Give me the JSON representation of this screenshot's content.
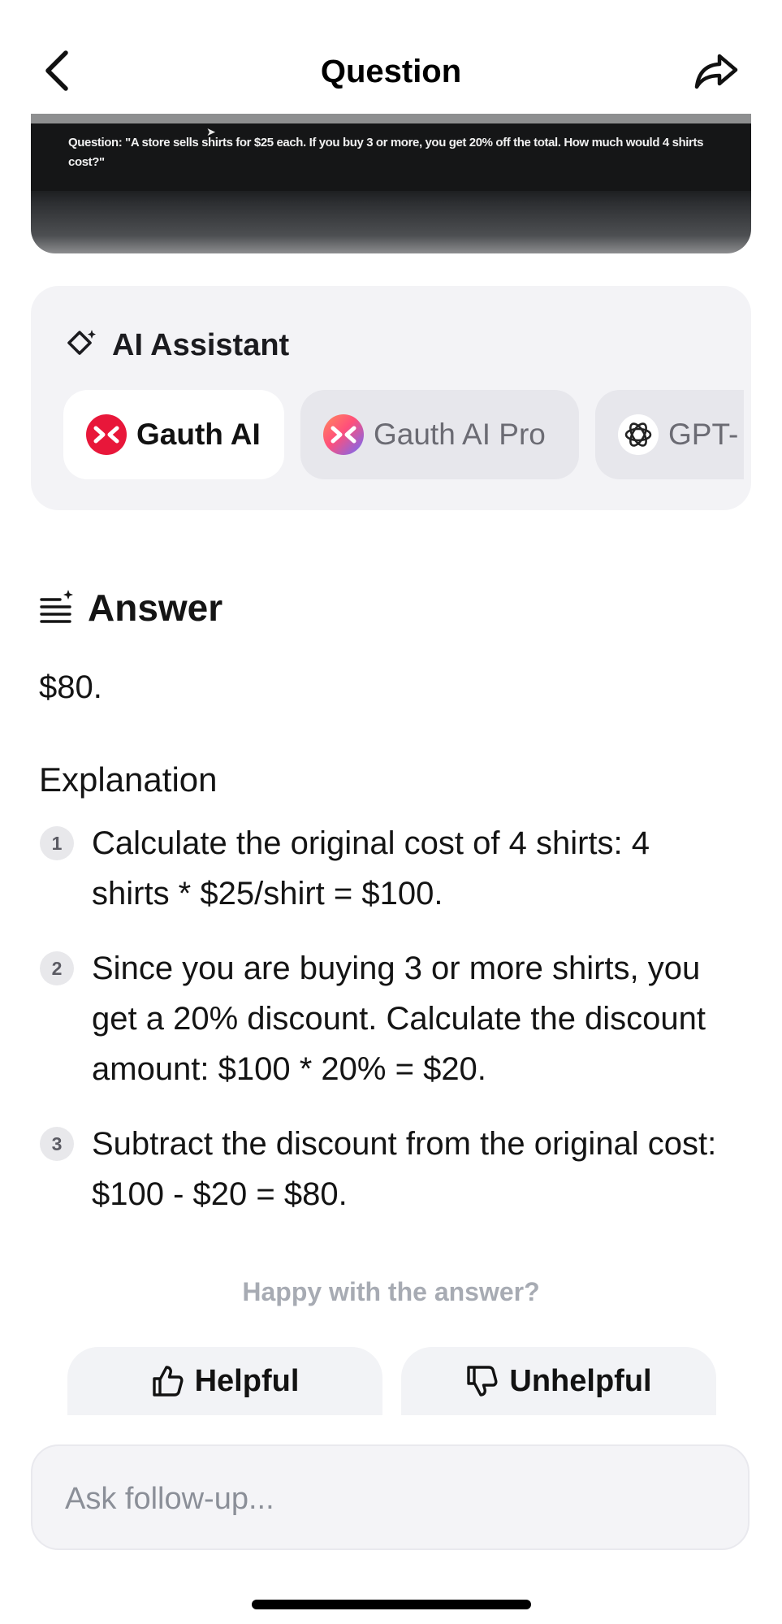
{
  "header": {
    "title": "Question",
    "back_icon": "chevron-left-icon",
    "share_icon": "share-arrow-icon"
  },
  "question_image": {
    "text": "Question: \"A store sells shirts for $25 each. If you buy 3 or more, you get 20% off the total. How much would 4 shirts cost?\""
  },
  "ai_assistant": {
    "heading": "AI Assistant",
    "icon": "sparkle-diamond-icon",
    "models": [
      {
        "label": "Gauth AI",
        "selected": true,
        "logo_color": "#e8173a"
      },
      {
        "label": "Gauth AI Pro",
        "selected": false,
        "logo_color": "#ff5b6e"
      },
      {
        "label": "GPT-",
        "selected": false,
        "logo_color": "#ffffff"
      }
    ]
  },
  "answer": {
    "heading": "Answer",
    "value": "$80.",
    "icon": "list-sparkle-icon"
  },
  "explanation": {
    "heading": "Explanation",
    "steps": [
      {
        "num": "1",
        "text": "Calculate the original cost of 4 shirts: 4 shirts * $25/shirt = $100."
      },
      {
        "num": "2",
        "text": "Since you are buying 3 or more shirts, you get a 20% discount. Calculate the discount amount: $100 * 20% = $20."
      },
      {
        "num": "3",
        "text": "Subtract the discount from the original cost: $100 - $20 = $80."
      }
    ]
  },
  "feedback": {
    "question": "Happy with the answer?",
    "helpful_label": "Helpful",
    "unhelpful_label": "Unhelpful"
  },
  "followup": {
    "placeholder": "Ask follow-up..."
  }
}
